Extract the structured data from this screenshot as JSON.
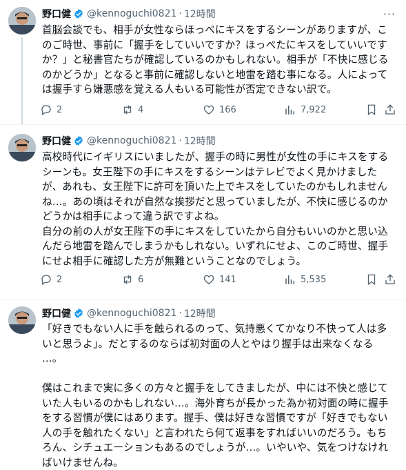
{
  "tweets": [
    {
      "author": "野口健",
      "handle": "@kennoguchi0821",
      "separator": "·",
      "time": "12時間",
      "text": "首脳会談でも、相手が女性ならほっぺにキスをするシーンがありますが、こ\nのご時世、事前に「握手をしていいですか？ほっぺたにキスをしていいです\nか？」と秘書官たちが確認しているのかもしれない。相手が「不快に感じる\nのかどうか」となると事前に確認しないと地雷を踏む事になる。人によって\nは握手すら嫌悪感を覚える人もいる可能性が否定できない訳で。",
      "replies": "2",
      "reposts": "4",
      "likes": "166",
      "views": "7,922"
    },
    {
      "author": "野口健",
      "handle": "@kennoguchi0821",
      "separator": "·",
      "time": "12時間",
      "text": "高校時代にイギリスにいましたが、握手の時に男性が女性の手にキスをする\nシーンも。女王陛下の手にキスをするシーンはテレビでよく見かけました\nが、あれも、女王陛下に許可を頂いた上でキスをしていたのかもしれません\nね…。あの頃はそれが自然な挨拶だと思っていましたが、不快に感じるのか\nどうかは相手によって違う訳ですよね。\n自分の前の人が女王陛下の手にキスをしていたから自分もいいのかと思い込\nんだら地雷を踏んでしまうかもしれない。いずれにせよ、このご時世、握手\nにせよ相手に確認した方が無難ということなのでしょう。",
      "replies": "2",
      "reposts": "6",
      "likes": "141",
      "views": "5,535"
    },
    {
      "author": "野口健",
      "handle": "@kennoguchi0821",
      "separator": "·",
      "time": "12時間",
      "text": "「好きでもない人に手を触られるのって、気持悪くてかなり不快って人は多\nいと思うよ」。だとするのならば初対面の人とやはり握手は出来なくなる\n…。\n\n僕はこれまで実に多くの方々と握手をしてきましたが、中には不快と感じて\nいた人もいるのかもしれない…。海外育ちが長かった為か初対面の時に握手\nをする習慣が僕にはあります。握手、僕は好きな習慣ですが「好きでもない\n人の手を触れたくない」と言われたら何て返事をすればいいのだろう。もち\nろん、シチュエーションもあるのでしょうが…。いやいや、気をつけなけれ\nばいけませんね。"
    }
  ],
  "ui": {
    "more_glyph": "···",
    "verified_color": "#1d9bf0",
    "text_color": "#0f1419",
    "muted_color": "#536471"
  }
}
